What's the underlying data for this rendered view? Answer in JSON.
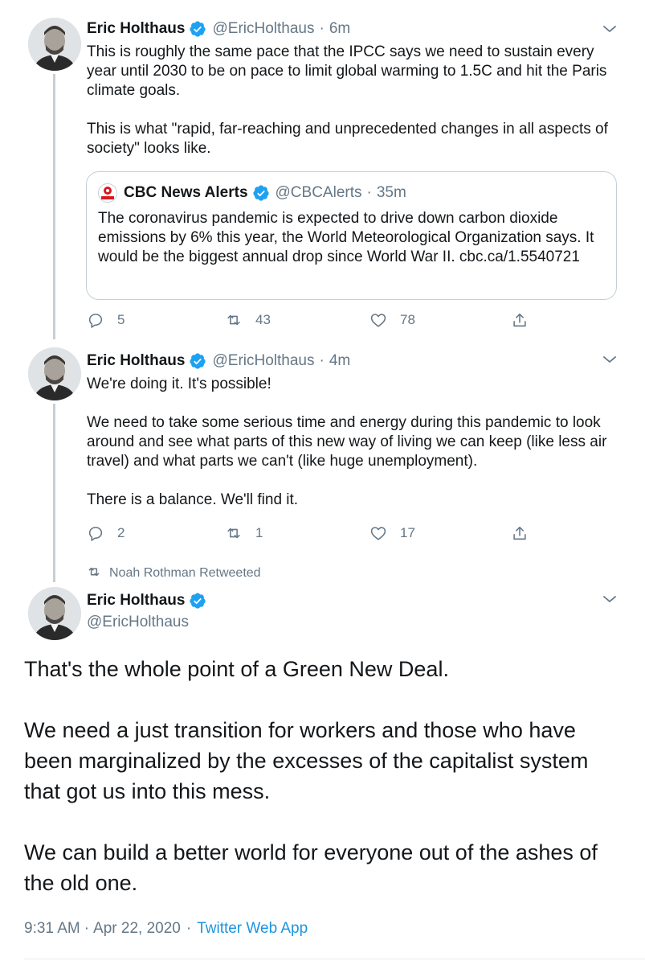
{
  "tweets": [
    {
      "author_name": "Eric Holthaus",
      "author_handle": "@EricHolthaus",
      "time": "6m",
      "paragraphs": [
        "This is roughly the same pace that the IPCC says we need to sustain every year until 2030 to be on pace to limit global warming to 1.5C and hit the Paris climate goals.",
        "This is what \"rapid, far-reaching and unprecedented changes in all aspects of society\" looks like."
      ],
      "quote": {
        "author_name": "CBC News Alerts",
        "author_handle": "@CBCAlerts",
        "time": "35m",
        "text": "The coronavirus pandemic is expected to drive down carbon dioxide emissions by 6% this year, the World Meteorological Organization says. It would be the biggest annual drop since World War II. cbc.ca/1.5540721"
      },
      "replies": "5",
      "retweets": "43",
      "likes": "78"
    },
    {
      "author_name": "Eric Holthaus",
      "author_handle": "@EricHolthaus",
      "time": "4m",
      "paragraphs": [
        "We're doing it. It's possible!",
        "We need to take some serious time and energy during this pandemic to look around and see what parts of this new way of living we can keep (like less air travel) and what parts we can't (like huge unemployment).",
        "There is a balance. We'll find it."
      ],
      "replies": "2",
      "retweets": "1",
      "likes": "17"
    }
  ],
  "main_tweet": {
    "retweeted_by": "Noah Rothman Retweeted",
    "author_name": "Eric Holthaus",
    "author_handle": "@EricHolthaus",
    "paragraphs": [
      "That's the whole point of a Green New Deal.",
      "We need a just transition for workers and those who have been marginalized by the excesses of the capitalist system that got us into this mess.",
      "We can build a better world for everyone out of the ashes of the old one."
    ],
    "time": "9:31 AM",
    "date": "Apr 22, 2020",
    "separator": "·",
    "app": "Twitter Web App"
  },
  "separator": "·",
  "colors": {
    "verified_blue": "#1da1f2",
    "secondary_text": "#657786",
    "link_blue": "#1b95e0",
    "thread_line": "#c4cfd6"
  },
  "icons": {
    "verified": "verified-badge-icon",
    "chevron": "chevron-down-icon",
    "reply": "reply-icon",
    "retweet": "retweet-icon",
    "like": "heart-icon",
    "share": "share-icon"
  }
}
